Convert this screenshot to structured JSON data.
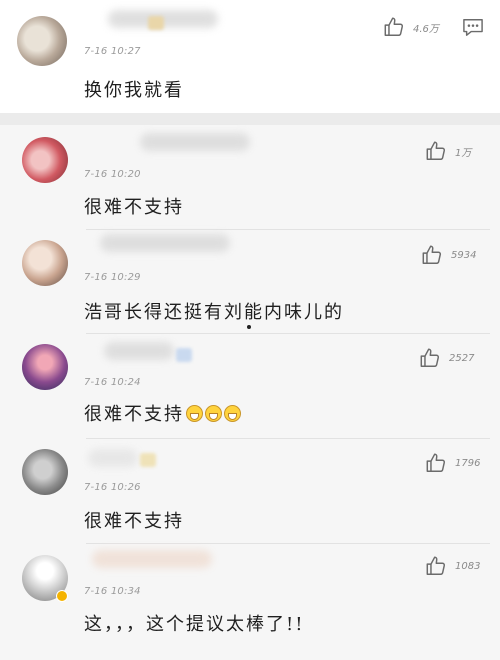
{
  "comments": [
    {
      "time": "7-16 10:27",
      "text": "换你我就看",
      "likes": "4.6万"
    },
    {
      "time": "7-16 10:20",
      "text": "很难不支持",
      "likes": "1万"
    },
    {
      "time": "7-16 10:29",
      "text": "浩哥长得还挺有刘能内味儿的",
      "likes": "5934"
    },
    {
      "time": "7-16 10:24",
      "text": "很难不支持",
      "likes": "2527"
    },
    {
      "time": "7-16 10:26",
      "text": "很难不支持",
      "likes": "1796"
    },
    {
      "time": "7-16 10:34",
      "text": "这，，，这个提议太棒了!!",
      "likes": "1083"
    }
  ],
  "icons": {
    "like": "thumbs-up-icon",
    "reply": "comment-reply-icon",
    "emoji": "grinning-face-emoji"
  },
  "colors": {
    "icon": "#6b6b6b",
    "verified": "#f5b300",
    "emoji": "#ffd33d"
  }
}
